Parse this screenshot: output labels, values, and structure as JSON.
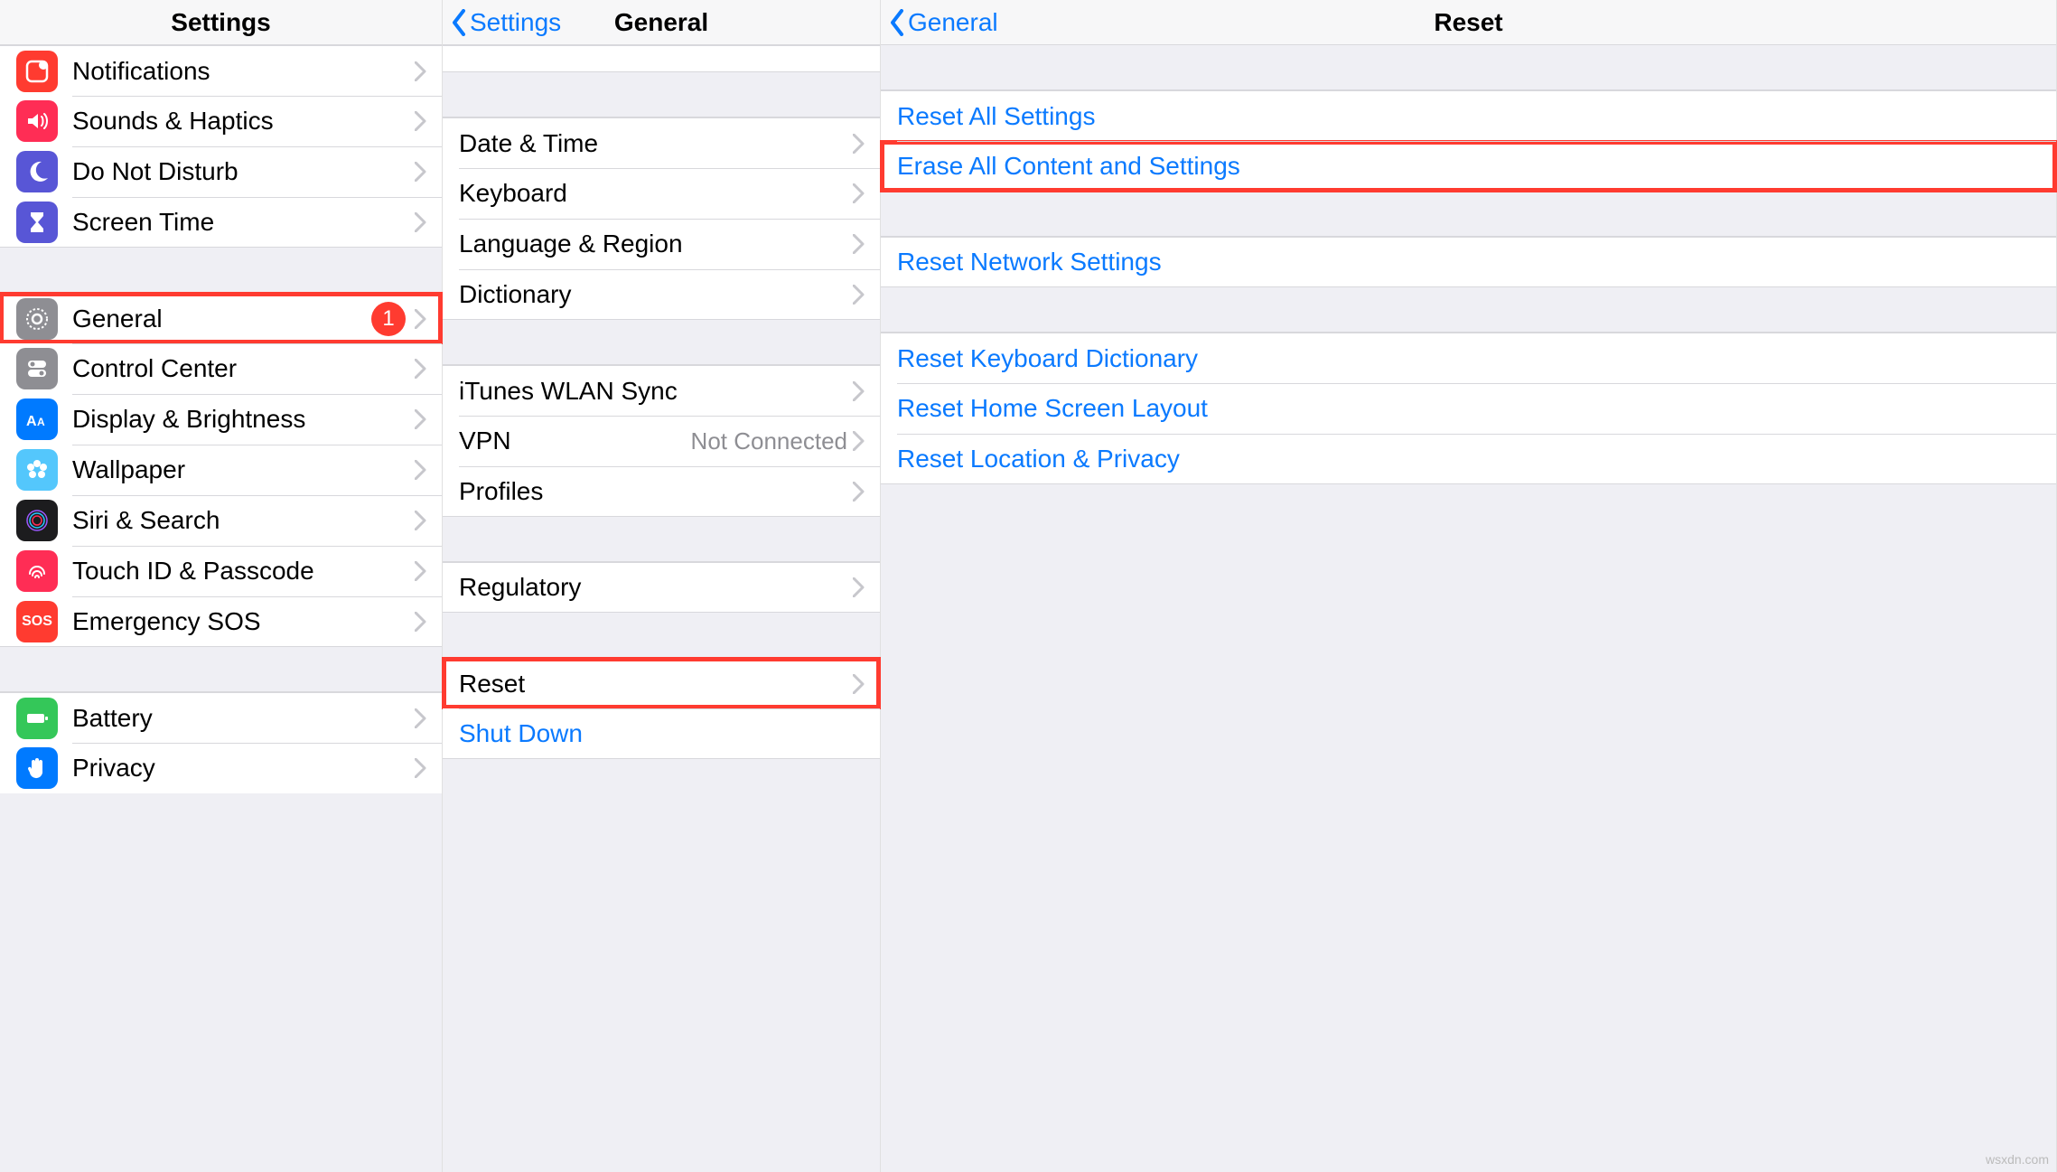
{
  "panel1": {
    "title": "Settings",
    "rows": [
      {
        "label": "Notifications"
      },
      {
        "label": "Sounds & Haptics"
      },
      {
        "label": "Do Not Disturb"
      },
      {
        "label": "Screen Time"
      },
      {
        "label": "General",
        "badge": "1",
        "highlight": true
      },
      {
        "label": "Control Center"
      },
      {
        "label": "Display & Brightness"
      },
      {
        "label": "Wallpaper"
      },
      {
        "label": "Siri & Search"
      },
      {
        "label": "Touch ID & Passcode"
      },
      {
        "label": "Emergency SOS",
        "sos": "SOS"
      },
      {
        "label": "Battery"
      },
      {
        "label": "Privacy"
      }
    ]
  },
  "panel2": {
    "back": "Settings",
    "title": "General",
    "rows": [
      {
        "label": "Date & Time"
      },
      {
        "label": "Keyboard"
      },
      {
        "label": "Language & Region"
      },
      {
        "label": "Dictionary"
      },
      {
        "label": "iTunes WLAN Sync"
      },
      {
        "label": "VPN",
        "detail": "Not Connected"
      },
      {
        "label": "Profiles"
      },
      {
        "label": "Regulatory"
      },
      {
        "label": "Reset",
        "highlight": true
      },
      {
        "label": "Shut Down",
        "blue": true
      }
    ]
  },
  "panel3": {
    "back": "General",
    "title": "Reset",
    "rows": [
      {
        "label": "Reset All Settings"
      },
      {
        "label": "Erase All Content and Settings",
        "highlight": true
      },
      {
        "label": "Reset Network Settings"
      },
      {
        "label": "Reset Keyboard Dictionary"
      },
      {
        "label": "Reset Home Screen Layout"
      },
      {
        "label": "Reset Location & Privacy"
      }
    ]
  },
  "watermark": "wsxdn.com"
}
